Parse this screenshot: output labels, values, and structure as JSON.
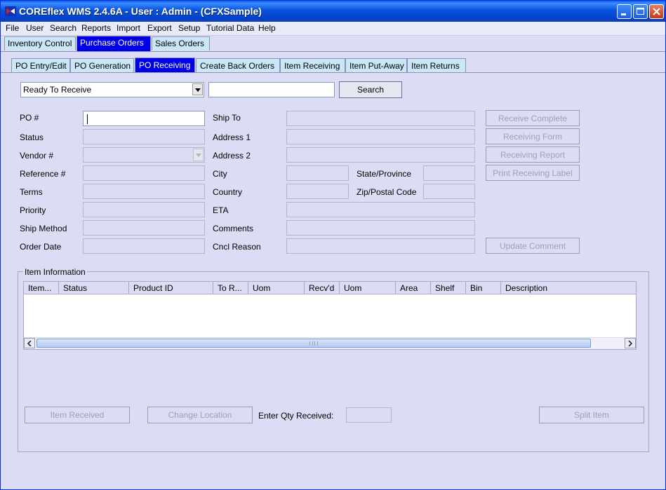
{
  "window": {
    "title": "COREflex WMS 2.4.6A - User : Admin - (CFXSample)",
    "icon": "coreflex-app-icon",
    "controls": [
      "minimize-icon",
      "maximize-icon",
      "close-icon"
    ]
  },
  "menu": [
    {
      "label": "File"
    },
    {
      "label": "User"
    },
    {
      "label": "Search"
    },
    {
      "label": "Reports"
    },
    {
      "label": "Import"
    },
    {
      "label": "Export"
    },
    {
      "label": "Setup"
    },
    {
      "label": "Tutorial Data"
    },
    {
      "label": "Help"
    }
  ],
  "main_tabs": [
    {
      "label": "Inventory Control",
      "active": false
    },
    {
      "label": "Purchase Orders",
      "active": true
    },
    {
      "label": "Sales Orders",
      "active": false
    }
  ],
  "sub_tabs": [
    {
      "label": "PO Entry/Edit",
      "active": false
    },
    {
      "label": "PO Generation",
      "active": false
    },
    {
      "label": "PO Receiving",
      "active": true
    },
    {
      "label": "Create Back Orders",
      "active": false
    },
    {
      "label": "Item Receiving",
      "active": false
    },
    {
      "label": "Item Put-Away",
      "active": false
    },
    {
      "label": "Item Returns",
      "active": false
    }
  ],
  "search": {
    "filter_value": "Ready To Receive",
    "text_value": "",
    "button_label": "Search"
  },
  "po_form": {
    "po_number": {
      "label": "PO #",
      "value": ""
    },
    "status": {
      "label": "Status",
      "value": ""
    },
    "vendor": {
      "label": "Vendor #",
      "value": ""
    },
    "reference": {
      "label": "Reference #",
      "value": ""
    },
    "terms": {
      "label": "Terms",
      "value": ""
    },
    "priority": {
      "label": "Priority",
      "value": ""
    },
    "ship_method": {
      "label": "Ship Method",
      "value": ""
    },
    "order_date": {
      "label": "Order Date",
      "value": ""
    },
    "ship_to": {
      "label": "Ship To",
      "value": ""
    },
    "address1": {
      "label": "Address 1",
      "value": ""
    },
    "address2": {
      "label": "Address 2",
      "value": ""
    },
    "city": {
      "label": "City",
      "value": ""
    },
    "state": {
      "label": "State/Province",
      "value": ""
    },
    "country": {
      "label": "Country",
      "value": ""
    },
    "zip": {
      "label": "Zip/Postal Code",
      "value": ""
    },
    "eta": {
      "label": "ETA",
      "value": ""
    },
    "comments": {
      "label": "Comments",
      "value": ""
    },
    "cancel_reason": {
      "label": "Cncl Reason",
      "value": ""
    }
  },
  "actions": {
    "receive_complete": "Receive Complete",
    "receiving_form": "Receiving Form",
    "receiving_report": "Receiving Report",
    "print_label": "Print Receiving Label",
    "update_comment": "Update Comment"
  },
  "item_info": {
    "title": "Item Information",
    "columns": [
      "Item...",
      "Status",
      "Product ID",
      "To R...",
      "Uom",
      "Recv'd",
      "Uom",
      "Area",
      "Shelf",
      "Bin",
      "Description"
    ],
    "rows": []
  },
  "bottom": {
    "item_received": "Item Received",
    "change_location": "Change Location",
    "qty_label": "Enter Qty Received:",
    "qty_value": "",
    "split_item": "Split Item"
  }
}
